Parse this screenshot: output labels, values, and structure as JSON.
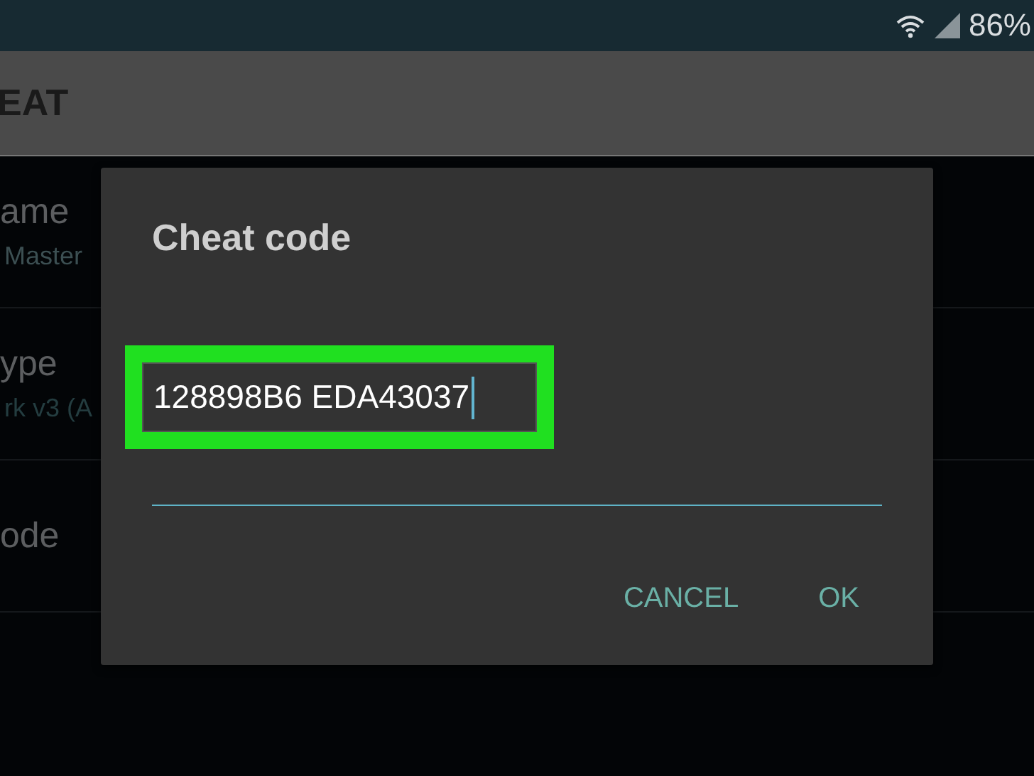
{
  "status_bar": {
    "battery": "86%"
  },
  "app_bar": {
    "title": "EAT"
  },
  "settings": [
    {
      "label": "ame",
      "value": "Master"
    },
    {
      "label": "ype",
      "value": "rk v3 (A"
    },
    {
      "label": "ode"
    }
  ],
  "dialog": {
    "title": "Cheat code",
    "field": {
      "value": "128898B6 EDA43037",
      "highlighted": true
    },
    "buttons": [
      "CANCEL",
      "OK"
    ]
  }
}
